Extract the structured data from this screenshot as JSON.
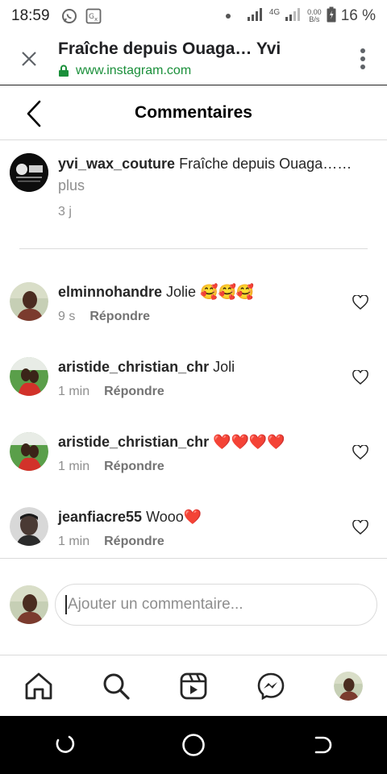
{
  "status_bar": {
    "time": "18:59",
    "network": "4G",
    "speed_top": "0.00",
    "speed_bottom": "B/s",
    "battery": "16 %"
  },
  "browser": {
    "title": "Fraîche depuis Ouaga… Yvi",
    "url": "www.instagram.com"
  },
  "header": {
    "title": "Commentaires"
  },
  "caption": {
    "username": "yvi_wax_couture",
    "text": "Fraîche depuis Ouaga……",
    "more": "plus",
    "time": "3 j"
  },
  "comments": [
    {
      "username": "elminnohandre",
      "text": "Jolie 🥰🥰🥰",
      "time": "9 s",
      "reply": "Répondre"
    },
    {
      "username": "aristide_christian_chr",
      "text": "Joli",
      "time": "1 min",
      "reply": "Répondre"
    },
    {
      "username": "aristide_christian_chr",
      "text": "❤️❤️❤️❤️",
      "time": "1 min",
      "reply": "Répondre"
    },
    {
      "username": "jeanfiacre55",
      "text": "Wooo❤️",
      "time": "1 min",
      "reply": "Répondre"
    }
  ],
  "composer": {
    "placeholder": "Ajouter un commentaire..."
  },
  "icons": {
    "close": "close-icon",
    "menu": "more-vert-icon",
    "lock": "lock-icon",
    "back": "chevron-left-icon",
    "heart": "heart-icon",
    "home": "home-icon",
    "search": "search-icon",
    "reels": "reels-icon",
    "messenger": "messenger-icon"
  }
}
